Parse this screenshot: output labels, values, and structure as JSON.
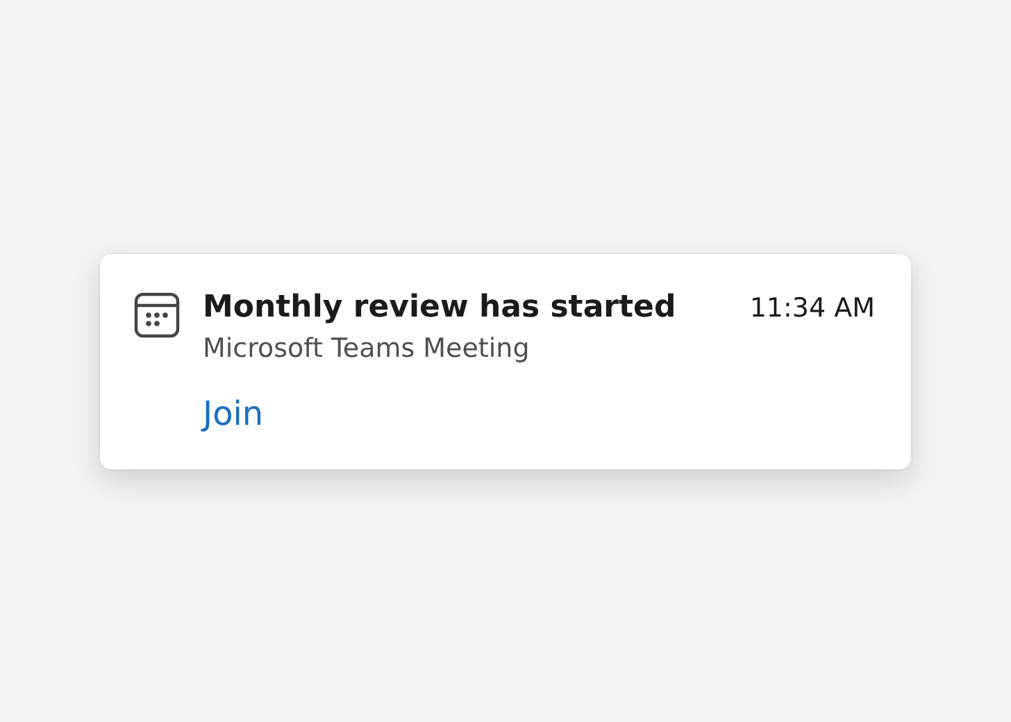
{
  "notification": {
    "title": "Monthly review has started",
    "time": "11:34 AM",
    "subtitle": "Microsoft Teams Meeting",
    "action": "Join"
  }
}
